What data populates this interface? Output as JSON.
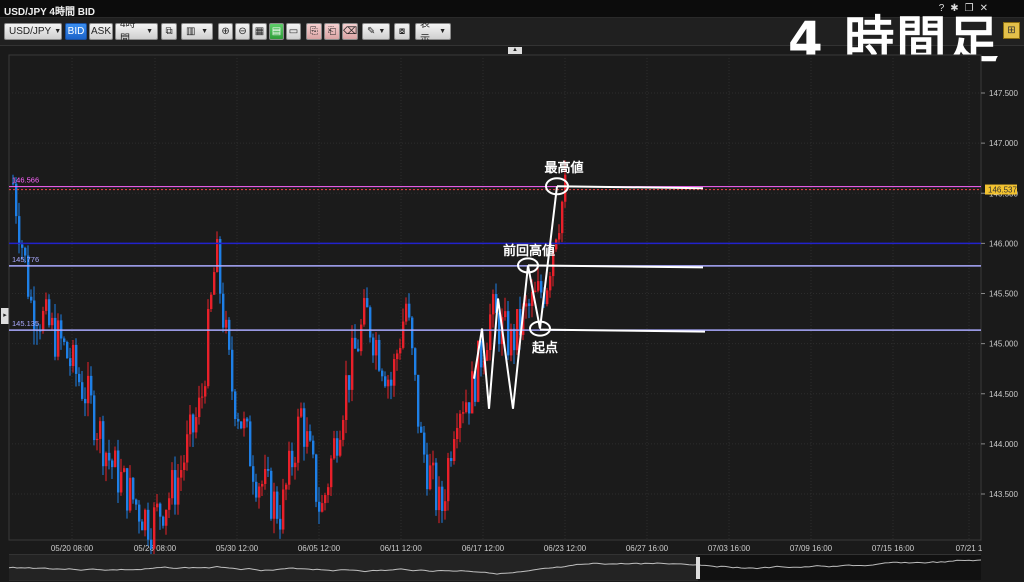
{
  "window": {
    "title": "USD/JPY 4時間 BID"
  },
  "toolbar": {
    "symbol": "USD/JPY",
    "bid_label": "BID",
    "ask_label": "ASK",
    "timeframe": "4時間",
    "display_label": "表示"
  },
  "headline": "4 時間足",
  "chart": {
    "price_labels": [
      "147.500",
      "147.000",
      "146.500",
      "146.000",
      "145.500",
      "145.000",
      "144.500",
      "144.000",
      "143.500"
    ],
    "date_labels": [
      "05/20 08:00",
      "05/26 08:00",
      "05/30 12:00",
      "06/05 12:00",
      "06/11 12:00",
      "06/17 12:00",
      "06/23 12:00",
      "06/27 16:00",
      "07/03 16:00",
      "07/09 16:00",
      "07/15 16:00",
      "07/21 1"
    ],
    "current_price": "146.537",
    "levels": [
      {
        "value": "146.566",
        "color": "#ff66ff"
      },
      {
        "value": "145.776",
        "color": "#aaaaff"
      },
      {
        "value": "145.135",
        "color": "#aaaaff"
      }
    ],
    "annotations": {
      "high": "最高値",
      "prev_high": "前回高値",
      "start": "起点"
    },
    "colors": {
      "up": "#e8202a",
      "down": "#1e7fe6",
      "blue_line": "#2222cc",
      "level_line": "#9999ee"
    }
  },
  "icons": [
    "chart-type-icon",
    "zoom-in-icon",
    "zoom-out-icon",
    "layout-icon",
    "draw-icon",
    "help-icon",
    "settings-icon",
    "close-icon"
  ]
}
